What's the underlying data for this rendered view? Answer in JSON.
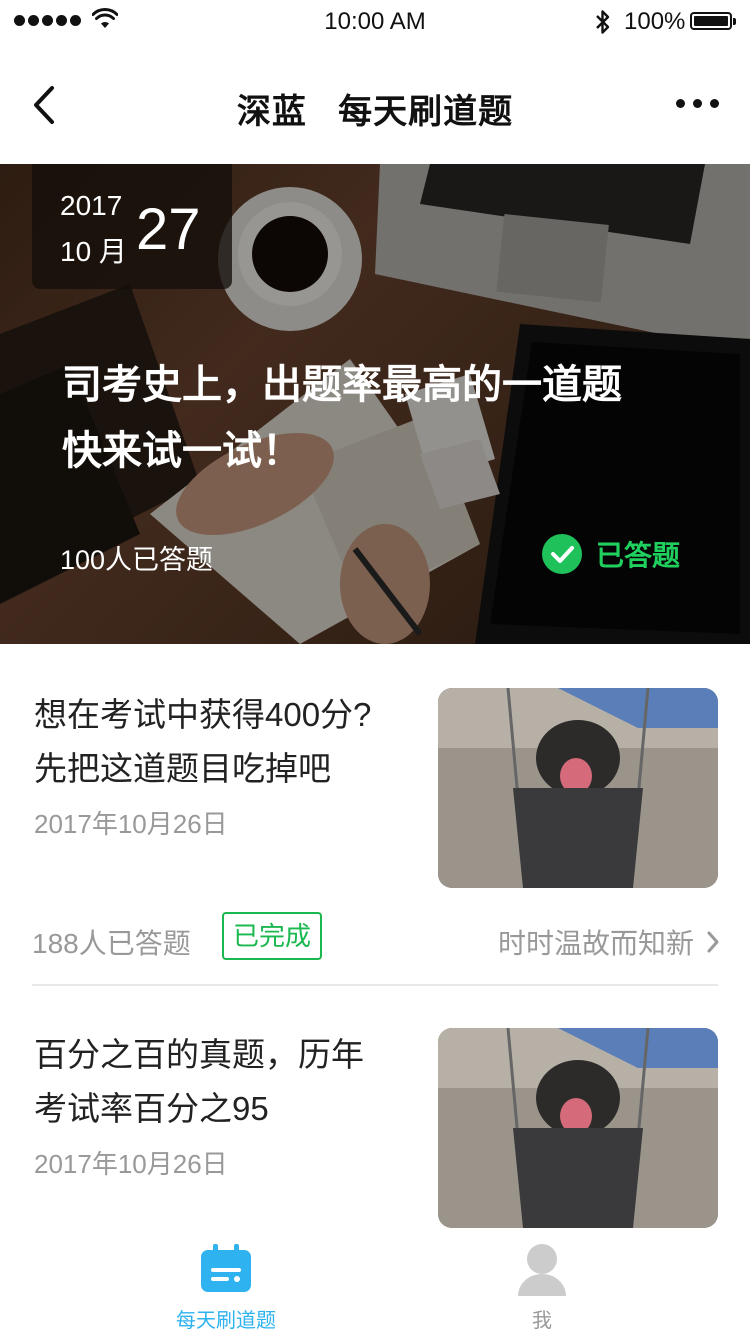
{
  "status_bar": {
    "time": "10:00 AM",
    "battery": "100%"
  },
  "nav": {
    "title": "深蓝   每天刷道题"
  },
  "hero": {
    "year": "2017",
    "month": "10 月",
    "day": "27",
    "title_lines": [
      "司考史上，出题率最高的一道题",
      "快来试一试！"
    ],
    "answered_count": "100人已答题",
    "answered_status": "已答题",
    "colors": {
      "answered_green": "#1fc25a"
    }
  },
  "cards": [
    {
      "title_lines": [
        "想在考试中获得400分?",
        "先把这道题目吃掉吧"
      ],
      "date": "2017年10月26日",
      "footer": {
        "count": "188人已答题",
        "badge": "已完成",
        "link": "时时温故而知新"
      }
    },
    {
      "title_lines": [
        "百分之百的真题，历年",
        "考试率百分之95"
      ],
      "date": "2017年10月26日"
    }
  ],
  "tab_bar": {
    "tabs": [
      {
        "label": "每天刷道题",
        "icon": "calendar-icon",
        "active": true
      },
      {
        "label": "我",
        "icon": "user-icon",
        "active": false
      }
    ],
    "colors": {
      "active": "#2fb2f0",
      "inactive": "#999999"
    }
  }
}
